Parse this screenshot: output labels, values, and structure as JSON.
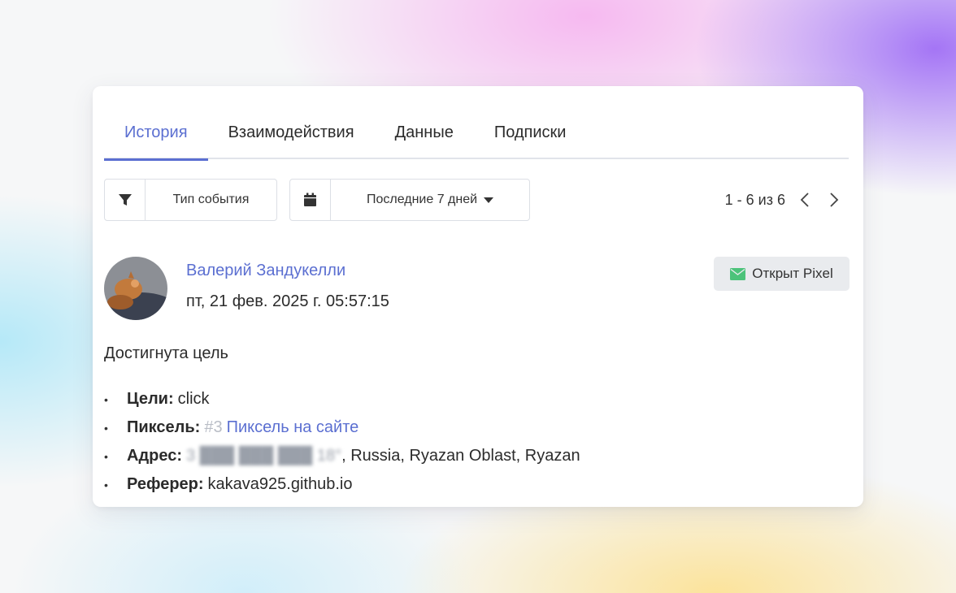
{
  "tabs": [
    {
      "label": "История",
      "active": true
    },
    {
      "label": "Взаимодействия",
      "active": false
    },
    {
      "label": "Данные",
      "active": false
    },
    {
      "label": "Подписки",
      "active": false
    }
  ],
  "filters": {
    "event_type": {
      "label": "Тип события",
      "icon": "filter-icon"
    },
    "date_range": {
      "label": "Последние 7 дней",
      "icon": "calendar-icon"
    }
  },
  "pagination": {
    "range": "1 - 6 из 6"
  },
  "event": {
    "user_name": "Валерий Зандукелли",
    "timestamp": "пт, 21 фев. 2025 г. 05:57:15",
    "status_badge": "Открыт Pixel",
    "status_icon": "envelope-icon",
    "status_color": "#4cc37a",
    "description": "Достигнута цель",
    "details": {
      "goals": {
        "label": "Цели:",
        "value": "click"
      },
      "pixel": {
        "label": "Пиксель:",
        "id": "#3",
        "name": "Пиксель на сайте"
      },
      "address": {
        "label": "Адрес:",
        "masked": "3 ███ ███ ███ 18°",
        "value": ", Russia, Ryazan Oblast, Ryazan"
      },
      "referrer": {
        "label": "Реферер:",
        "value": "kakava925.github.io"
      }
    }
  },
  "colors": {
    "accent": "#5b6fd1",
    "badge_bg": "#e9ebee"
  }
}
